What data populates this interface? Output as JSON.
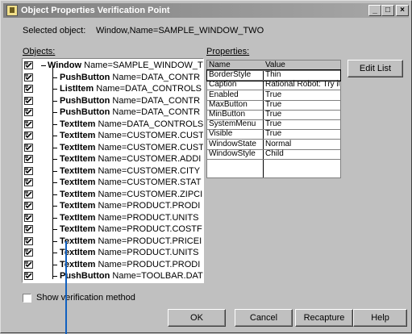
{
  "titlebar": {
    "title": "Object Properties Verification Point",
    "minimize_glyph": "_",
    "maximize_glyph": "□",
    "close_glyph": "×"
  },
  "selected": {
    "label": "Selected object:",
    "value": "Window,Name=SAMPLE_WINDOW_TWO"
  },
  "objects_label": "Objects:",
  "properties_label": "Properties:",
  "tree": [
    {
      "type": "Window",
      "name": "Name=SAMPLE_WINDOW_TV"
    },
    {
      "type": "PushButton",
      "name": "Name=DATA_CONTR"
    },
    {
      "type": "ListItem",
      "name": "Name=DATA_CONTROLS"
    },
    {
      "type": "PushButton",
      "name": "Name=DATA_CONTR"
    },
    {
      "type": "PushButton",
      "name": "Name=DATA_CONTR"
    },
    {
      "type": "TextItem",
      "name": "Name=DATA_CONTROLS"
    },
    {
      "type": "TextItem",
      "name": "Name=CUSTOMER.CUST"
    },
    {
      "type": "TextItem",
      "name": "Name=CUSTOMER.CUST"
    },
    {
      "type": "TextItem",
      "name": "Name=CUSTOMER.ADDI"
    },
    {
      "type": "TextItem",
      "name": "Name=CUSTOMER.CITY"
    },
    {
      "type": "TextItem",
      "name": "Name=CUSTOMER.STAT"
    },
    {
      "type": "TextItem",
      "name": "Name=CUSTOMER.ZIPCI"
    },
    {
      "type": "TextItem",
      "name": "Name=PRODUCT.PRODI"
    },
    {
      "type": "TextItem",
      "name": "Name=PRODUCT.UNITS"
    },
    {
      "type": "TextItem",
      "name": "Name=PRODUCT.COSTF"
    },
    {
      "type": "TextItem",
      "name": "Name=PRODUCT.PRICEI"
    },
    {
      "type": "TextItem",
      "name": "Name=PRODUCT.UNITS"
    },
    {
      "type": "TextItem",
      "name": "Name=PRODUCT.PRODI"
    },
    {
      "type": "PushButton",
      "name": "Name=TOOLBAR.DAT"
    }
  ],
  "properties": {
    "header": {
      "name": "Name",
      "value": "Value"
    },
    "rows": [
      {
        "name": "BorderStyle",
        "value": "Thin"
      },
      {
        "name": "Caption",
        "value": "Rational Robot:  Try it"
      },
      {
        "name": "Enabled",
        "value": "True"
      },
      {
        "name": "MaxButton",
        "value": "True"
      },
      {
        "name": "MinButton",
        "value": "True"
      },
      {
        "name": "SystemMenu",
        "value": "True"
      },
      {
        "name": "Visible",
        "value": "True"
      },
      {
        "name": "WindowState",
        "value": "Normal"
      },
      {
        "name": "WindowStyle",
        "value": "Child"
      }
    ]
  },
  "buttons": {
    "edit_list": "Edit List",
    "ok": "OK",
    "cancel": "Cancel",
    "recapture": "Recapture",
    "help": "Help"
  },
  "show_verification": "Show verification method",
  "colors": {
    "title_bg": "#808080",
    "check_icon": "#2a2a2a",
    "cursor": "#1060c0"
  }
}
